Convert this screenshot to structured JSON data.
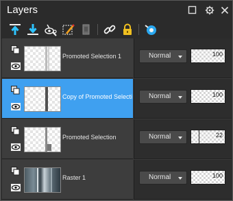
{
  "panel": {
    "title": "Layers"
  },
  "titlebar_controls": [
    "maximize-icon",
    "options-icon",
    "close-icon"
  ],
  "toolbar": {
    "tools": [
      "new-layer-icon",
      "merge-down-icon",
      "link-visibility-icon",
      "edit-selection-icon",
      "lock-transparency-icon",
      "link-layers-icon",
      "lock-layer-icon",
      "highlight-icon"
    ]
  },
  "colors": {
    "selected_row": "#3fa0f0",
    "panel_bg": "#2f2f2f"
  },
  "layers": [
    {
      "name": "Promoted Selection 1",
      "blend_mode": "Normal",
      "opacity": "100",
      "opacity_fraction": 1.0,
      "selected": false
    },
    {
      "name": "Copy of Promoted Selection",
      "blend_mode": "Normal",
      "opacity": "100",
      "opacity_fraction": 1.0,
      "selected": true
    },
    {
      "name": "Promoted Selection",
      "blend_mode": "Normal",
      "opacity": "22",
      "opacity_fraction": 0.22,
      "selected": false
    },
    {
      "name": "Raster 1",
      "blend_mode": "Normal",
      "opacity": "100",
      "opacity_fraction": 1.0,
      "selected": false
    }
  ]
}
